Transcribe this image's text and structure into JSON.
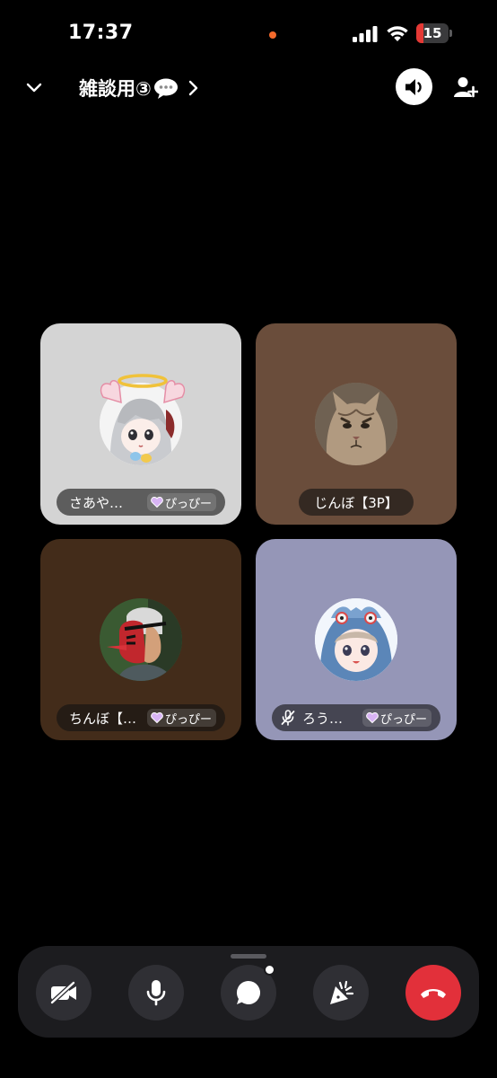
{
  "status_bar": {
    "time": "17:37",
    "battery_level": "15",
    "battery_fraction": 0.15,
    "recording_dot_color": "#f36a2c",
    "battery_color": "#e53935"
  },
  "header": {
    "channel_name": "雑談用③",
    "channel_emoji": "speech-balloon-icon",
    "speaker_active": true
  },
  "tiles": [
    {
      "name": "さあや…",
      "badge": "ぴっぴー",
      "bg": "#d4d4d4",
      "muted": false,
      "avatar": "anime-angel-girl"
    },
    {
      "name": "じんぼ【3P】",
      "badge": "",
      "bg": "#6a4d3b",
      "muted": false,
      "avatar": "tabby-cat"
    },
    {
      "name": "ちんぼ【…",
      "badge": "ぴっぴー",
      "bg": "#432c1a",
      "muted": false,
      "avatar": "tengu-mask-man"
    },
    {
      "name": "ろう…",
      "badge": "ぴっぴー",
      "bg": "#9596b7",
      "muted": true,
      "avatar": "anime-dino-hood-boy"
    }
  ],
  "controls": {
    "camera": "camera-off-icon",
    "mic": "microphone-icon",
    "chat": "chat-bubble-icon",
    "activities": "party-popper-icon",
    "end_call": "end-call-icon",
    "accent_red": "#e2303a",
    "chat_has_notification": true
  }
}
